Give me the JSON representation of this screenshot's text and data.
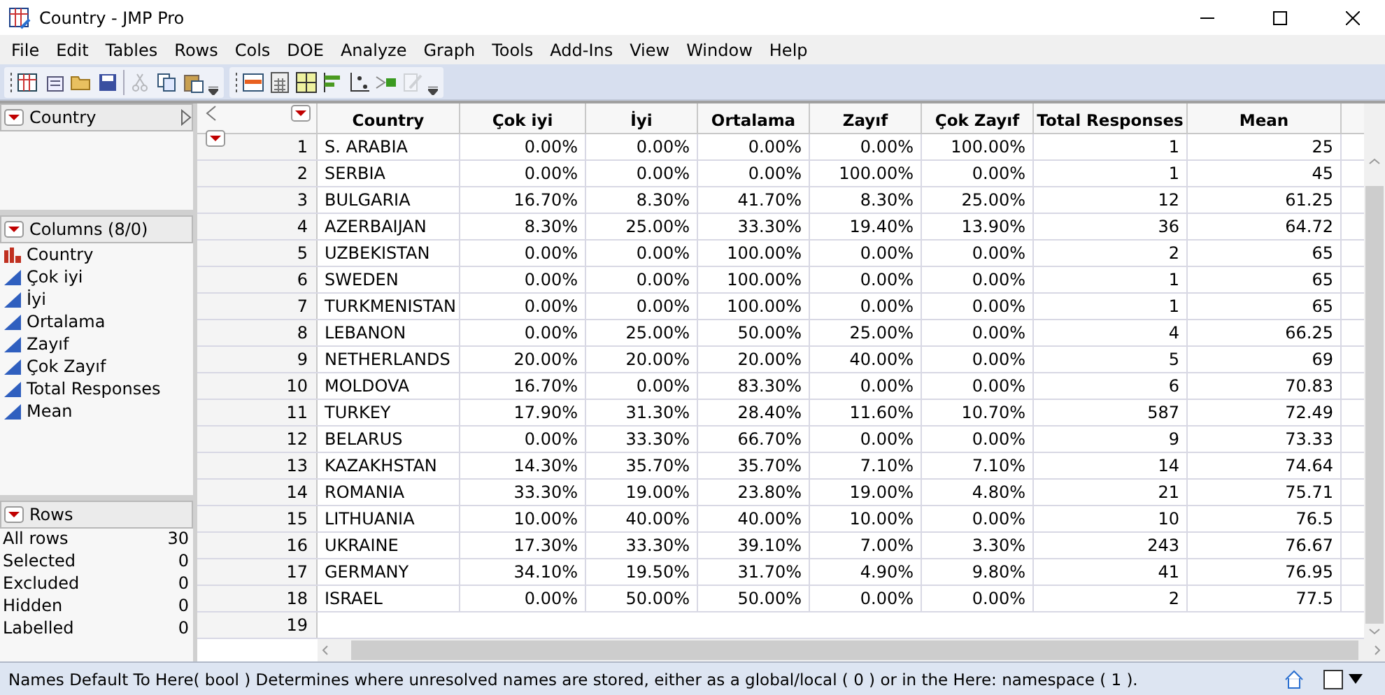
{
  "window": {
    "title": "Country - JMP Pro"
  },
  "menu": [
    "File",
    "Edit",
    "Tables",
    "Rows",
    "Cols",
    "DOE",
    "Analyze",
    "Graph",
    "Tools",
    "Add-Ins",
    "View",
    "Window",
    "Help"
  ],
  "toolbar": [
    {
      "items": [
        {
          "kind": "new-table",
          "disabled": false
        },
        {
          "kind": "new-script",
          "disabled": false
        },
        {
          "kind": "open",
          "disabled": false
        },
        {
          "kind": "save",
          "disabled": false
        },
        {
          "kind": "sep"
        },
        {
          "kind": "cut",
          "disabled": true
        },
        {
          "kind": "copy",
          "disabled": false
        },
        {
          "kind": "paste",
          "disabled": false
        },
        {
          "kind": "more"
        }
      ]
    },
    {
      "items": [
        {
          "kind": "data-table",
          "disabled": false
        },
        {
          "kind": "calculator",
          "disabled": false
        },
        {
          "kind": "grid",
          "disabled": false
        },
        {
          "kind": "bars",
          "disabled": false
        },
        {
          "kind": "fit",
          "disabled": false
        },
        {
          "kind": "arrow",
          "disabled": false
        },
        {
          "kind": "edit",
          "disabled": true
        },
        {
          "kind": "more"
        }
      ]
    }
  ],
  "table_panel": {
    "title": "Country"
  },
  "columns_panel": {
    "title": "Columns (8/0)",
    "items": [
      {
        "name": "Country",
        "kind": "nominal"
      },
      {
        "name": "Çok iyi",
        "kind": "continuous"
      },
      {
        "name": "İyi",
        "kind": "continuous"
      },
      {
        "name": "Ortalama",
        "kind": "continuous"
      },
      {
        "name": "Zayıf",
        "kind": "continuous"
      },
      {
        "name": "Çok Zayıf",
        "kind": "continuous"
      },
      {
        "name": "Total Responses",
        "kind": "continuous"
      },
      {
        "name": "Mean",
        "kind": "continuous"
      }
    ]
  },
  "rows_panel": {
    "title": "Rows",
    "items": [
      {
        "label": "All rows",
        "value": "30"
      },
      {
        "label": "Selected",
        "value": "0"
      },
      {
        "label": "Excluded",
        "value": "0"
      },
      {
        "label": "Hidden",
        "value": "0"
      },
      {
        "label": "Labelled",
        "value": "0"
      }
    ]
  },
  "table": {
    "columns": [
      "Country",
      "Çok iyi",
      "İyi",
      "Ortalama",
      "Zayıf",
      "Çok Zayıf",
      "Total Responses",
      "Mean"
    ],
    "rows": [
      {
        "n": "1",
        "cells": [
          "S. ARABIA",
          "0.00%",
          "0.00%",
          "0.00%",
          "0.00%",
          "100.00%",
          "1",
          "25"
        ]
      },
      {
        "n": "2",
        "cells": [
          "SERBIA",
          "0.00%",
          "0.00%",
          "0.00%",
          "100.00%",
          "0.00%",
          "1",
          "45"
        ]
      },
      {
        "n": "3",
        "cells": [
          "BULGARIA",
          "16.70%",
          "8.30%",
          "41.70%",
          "8.30%",
          "25.00%",
          "12",
          "61.25"
        ]
      },
      {
        "n": "4",
        "cells": [
          "AZERBAIJAN",
          "8.30%",
          "25.00%",
          "33.30%",
          "19.40%",
          "13.90%",
          "36",
          "64.72"
        ]
      },
      {
        "n": "5",
        "cells": [
          "UZBEKISTAN",
          "0.00%",
          "0.00%",
          "100.00%",
          "0.00%",
          "0.00%",
          "2",
          "65"
        ]
      },
      {
        "n": "6",
        "cells": [
          "SWEDEN",
          "0.00%",
          "0.00%",
          "100.00%",
          "0.00%",
          "0.00%",
          "1",
          "65"
        ]
      },
      {
        "n": "7",
        "cells": [
          "TURKMENISTAN",
          "0.00%",
          "0.00%",
          "100.00%",
          "0.00%",
          "0.00%",
          "1",
          "65"
        ]
      },
      {
        "n": "8",
        "cells": [
          "LEBANON",
          "0.00%",
          "25.00%",
          "50.00%",
          "25.00%",
          "0.00%",
          "4",
          "66.25"
        ]
      },
      {
        "n": "9",
        "cells": [
          "NETHERLANDS",
          "20.00%",
          "20.00%",
          "20.00%",
          "40.00%",
          "0.00%",
          "5",
          "69"
        ]
      },
      {
        "n": "10",
        "cells": [
          "MOLDOVA",
          "16.70%",
          "0.00%",
          "83.30%",
          "0.00%",
          "0.00%",
          "6",
          "70.83"
        ]
      },
      {
        "n": "11",
        "cells": [
          "TURKEY",
          "17.90%",
          "31.30%",
          "28.40%",
          "11.60%",
          "10.70%",
          "587",
          "72.49"
        ]
      },
      {
        "n": "12",
        "cells": [
          "BELARUS",
          "0.00%",
          "33.30%",
          "66.70%",
          "0.00%",
          "0.00%",
          "9",
          "73.33"
        ]
      },
      {
        "n": "13",
        "cells": [
          "KAZAKHSTAN",
          "14.30%",
          "35.70%",
          "35.70%",
          "7.10%",
          "7.10%",
          "14",
          "74.64"
        ]
      },
      {
        "n": "14",
        "cells": [
          "ROMANIA",
          "33.30%",
          "19.00%",
          "23.80%",
          "19.00%",
          "4.80%",
          "21",
          "75.71"
        ]
      },
      {
        "n": "15",
        "cells": [
          "LITHUANIA",
          "10.00%",
          "40.00%",
          "40.00%",
          "10.00%",
          "0.00%",
          "10",
          "76.5"
        ]
      },
      {
        "n": "16",
        "cells": [
          "UKRAINE",
          "17.30%",
          "33.30%",
          "39.10%",
          "7.00%",
          "3.30%",
          "243",
          "76.67"
        ]
      },
      {
        "n": "17",
        "cells": [
          "GERMANY",
          "34.10%",
          "19.50%",
          "31.70%",
          "4.90%",
          "9.80%",
          "41",
          "76.95"
        ]
      },
      {
        "n": "18",
        "cells": [
          "ISRAEL",
          "0.00%",
          "50.00%",
          "50.00%",
          "0.00%",
          "0.00%",
          "2",
          "77.5"
        ]
      },
      {
        "n": "19",
        "cells": []
      }
    ]
  },
  "status_bar": {
    "text": "Names Default To Here( bool )  Determines where unresolved names are stored, either as a global/local ( 0 ) or in the Here: namespace ( 1 )."
  }
}
